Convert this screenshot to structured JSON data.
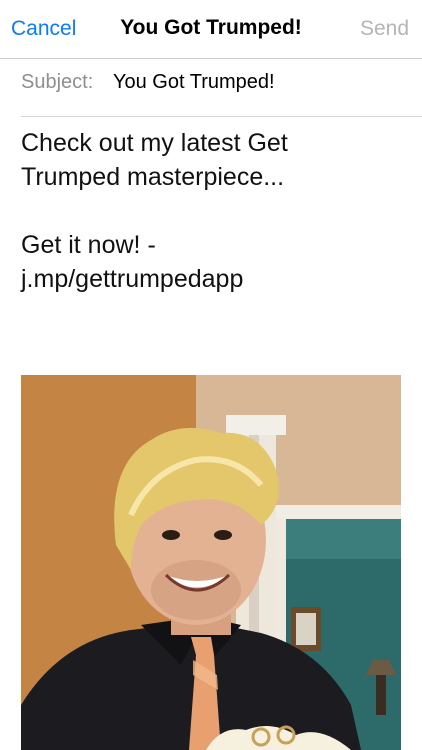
{
  "navbar": {
    "cancel_label": "Cancel",
    "title": "You Got Trumped!",
    "send_label": "Send"
  },
  "subject": {
    "label": "Subject:",
    "value": "You Got Trumped!"
  },
  "message": {
    "line1": "Check out my latest Get",
    "line2": "Trumped masterpiece...",
    "line3": "Get it now! -",
    "line4": "j.mp/gettrumpedapp"
  },
  "colors": {
    "accent": "#0a7aff",
    "disabled": "#b5b5b8",
    "label_gray": "#8e8e93"
  },
  "attachment": {
    "icon": "photo-attachment"
  }
}
